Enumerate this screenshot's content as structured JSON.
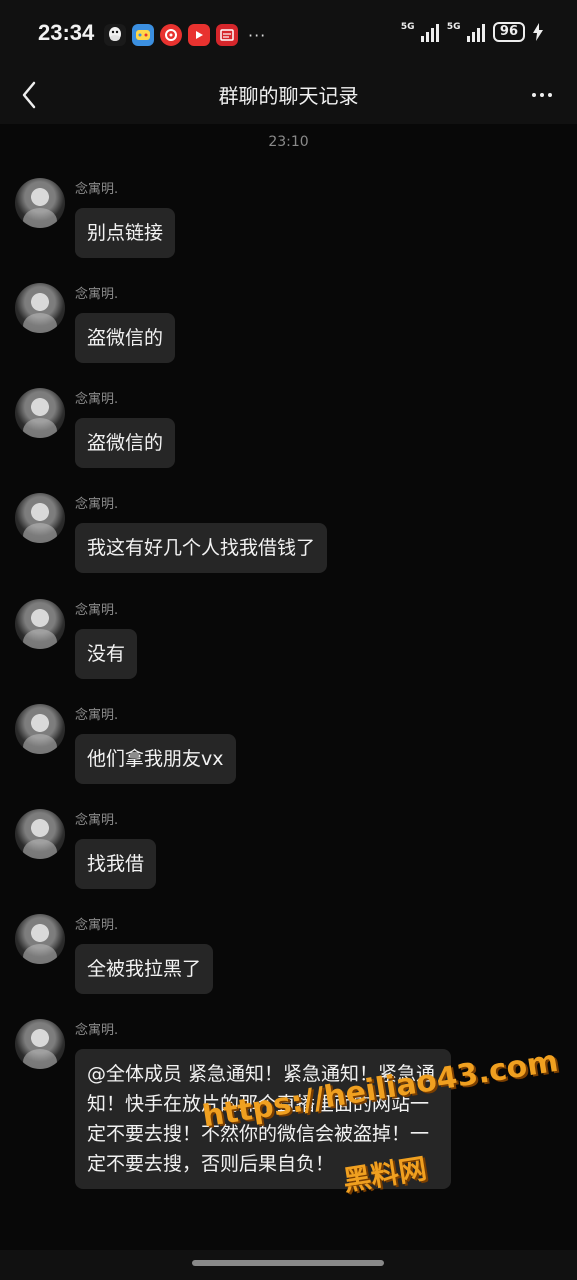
{
  "status_bar": {
    "time": "23:34",
    "app_icons": [
      {
        "name": "qq-icon",
        "color": "#1a1a1a",
        "glyph": "🐧"
      },
      {
        "name": "game-icon",
        "color": "#3b8fe0",
        "glyph": "▣"
      },
      {
        "name": "netease-music-icon",
        "color": "#e8322f",
        "glyph": "◉"
      },
      {
        "name": "video-app-icon",
        "color": "#e8322f",
        "glyph": "▶"
      },
      {
        "name": "news-app-icon",
        "color": "#d6262b",
        "glyph": "▤"
      }
    ],
    "more_indicator": "···",
    "signal_1_label": "5G",
    "signal_2_label": "5G",
    "battery": "96",
    "charging_icon": "charging-bolt-icon"
  },
  "nav": {
    "title": "群聊的聊天记录",
    "back_icon": "chevron-left-icon",
    "more_icon": "more-dots-icon"
  },
  "chat": {
    "time_separator": "23:10",
    "messages": [
      {
        "sender": "念寓明.",
        "text": "别点链接"
      },
      {
        "sender": "念寓明.",
        "text": "盗微信的"
      },
      {
        "sender": "念寓明.",
        "text": "盗微信的"
      },
      {
        "sender": "念寓明.",
        "text": "我这有好几个人找我借钱了"
      },
      {
        "sender": "念寓明.",
        "text": "没有"
      },
      {
        "sender": "念寓明.",
        "text": "他们拿我朋友vx"
      },
      {
        "sender": "念寓明.",
        "text": "找我借"
      },
      {
        "sender": "念寓明.",
        "text": "全被我拉黑了"
      },
      {
        "sender": "念寓明.",
        "text": "@全体成员  紧急通知！紧急通知！紧急通知！快手在放片的那个直播里面的网站一定不要去搜！不然你的微信会被盗掉！一定不要去搜，否则后果自负！"
      }
    ]
  },
  "watermark": {
    "url": "https://heiliao43.com",
    "name": "黑料网"
  },
  "colors": {
    "background": "#080808",
    "bubble": "#262626",
    "watermark": "#f0a020"
  }
}
